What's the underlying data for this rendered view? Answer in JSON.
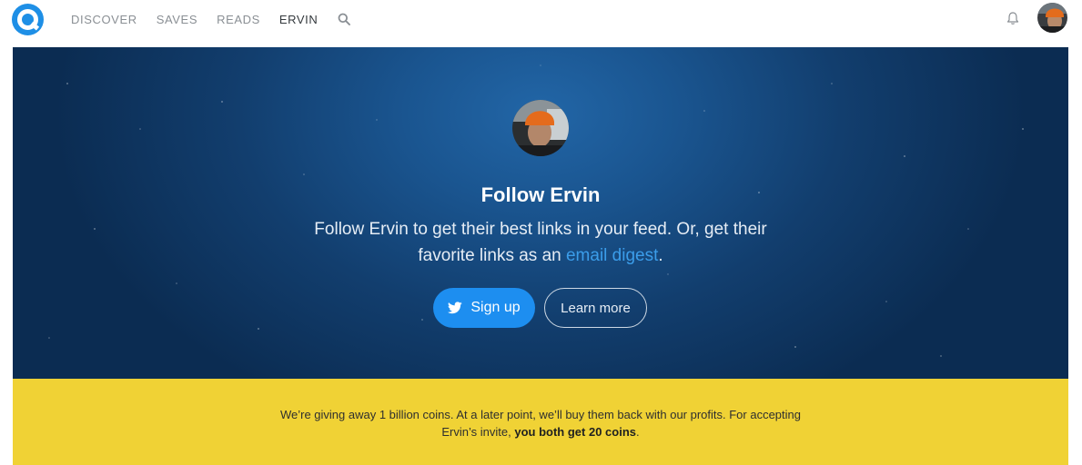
{
  "nav": {
    "items": [
      {
        "label": "DISCOVER",
        "active": false
      },
      {
        "label": "SAVES",
        "active": false
      },
      {
        "label": "READS",
        "active": false
      },
      {
        "label": "ERVIN",
        "active": true
      }
    ],
    "search_icon": "search-icon"
  },
  "header": {
    "logo_icon": "logo-icon",
    "bell_icon": "bell-icon",
    "avatar": "user-avatar"
  },
  "hero": {
    "title": "Follow Ervin",
    "text_before_link": "Follow Ervin to get their best links in your feed. Or, get their favorite links as an ",
    "link_text": "email digest",
    "text_after_link": ".",
    "signup_label": "Sign up",
    "learn_more_label": "Learn more"
  },
  "banner": {
    "text_main": "We’re giving away 1 billion coins. At a later point, we’ll buy them back with our profits. For accepting Ervin’s invite, ",
    "text_bold": "you both get 20 coins",
    "text_end": "."
  },
  "colors": {
    "brand": "#1e8fe6",
    "hero_bg": "#1a5590",
    "signup_button": "#1d8ef0",
    "banner_bg": "#f0d235",
    "link": "#3b9dea"
  }
}
